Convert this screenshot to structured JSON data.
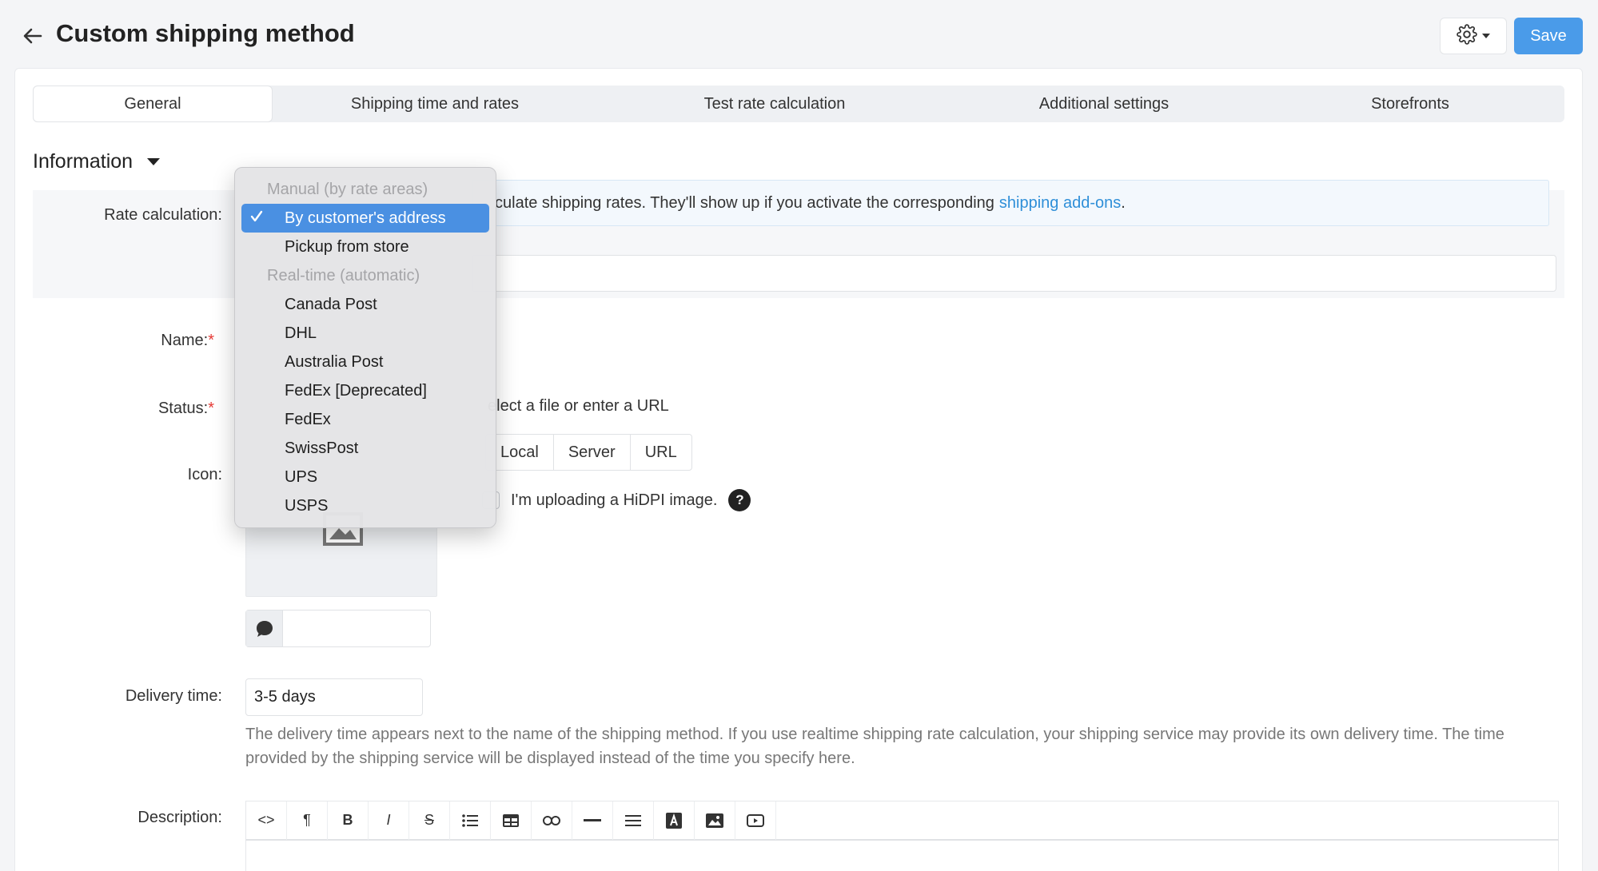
{
  "header": {
    "title": "Custom shipping method",
    "save_label": "Save"
  },
  "tabs": [
    {
      "label": "General",
      "active": true
    },
    {
      "label": "Shipping time and rates",
      "active": false
    },
    {
      "label": "Test rate calculation",
      "active": false
    },
    {
      "label": "Additional settings",
      "active": false
    },
    {
      "label": "Storefronts",
      "active": false
    }
  ],
  "section": {
    "title": "Information"
  },
  "form": {
    "rate_calculation_label": "Rate calculation:",
    "info_text": "culate shipping rates. They'll show up if you activate the corresponding",
    "info_link": "shipping add-ons",
    "info_end": ".",
    "name_label": "Name:",
    "status_label": "Status:",
    "icon_label": "Icon:",
    "icon_hint": "elect a file or enter a URL",
    "icon_sources": [
      "Local",
      "Server",
      "URL"
    ],
    "hidpi_label": "I'm uploading a HiDPI image.",
    "delivery_label": "Delivery time:",
    "delivery_value": "3-5 days",
    "delivery_help": "The delivery time appears next to the name of the shipping method. If you use realtime shipping rate calculation, your shipping service may provide its own delivery time. The time provided by the shipping service will be displayed instead of the time you specify here.",
    "description_label": "Description:"
  },
  "dropdown": {
    "items": [
      {
        "label": "Manual (by rate areas)",
        "type": "group"
      },
      {
        "label": "By customer's address",
        "type": "option",
        "selected": true
      },
      {
        "label": "Pickup from store",
        "type": "option"
      },
      {
        "label": "Real-time (automatic)",
        "type": "group"
      },
      {
        "label": "Canada Post",
        "type": "option"
      },
      {
        "label": "DHL",
        "type": "option"
      },
      {
        "label": "Australia Post",
        "type": "option"
      },
      {
        "label": "FedEx [Deprecated]",
        "type": "option"
      },
      {
        "label": "FedEx",
        "type": "option"
      },
      {
        "label": "SwissPost",
        "type": "option"
      },
      {
        "label": "UPS",
        "type": "option"
      },
      {
        "label": "USPS",
        "type": "option"
      }
    ]
  },
  "toolbar": {
    "buttons": [
      "code-icon",
      "paragraph-icon",
      "bold-icon",
      "italic-icon",
      "strikethrough-icon",
      "bullet-list-icon",
      "table-icon",
      "link-icon",
      "horizontal-rule-icon",
      "align-icon",
      "font-color-icon",
      "image-icon",
      "video-icon"
    ]
  },
  "colors": {
    "accent": "#4a9be9",
    "link": "#2f8fd8",
    "selection": "#4a90e2",
    "required": "#e53935"
  }
}
